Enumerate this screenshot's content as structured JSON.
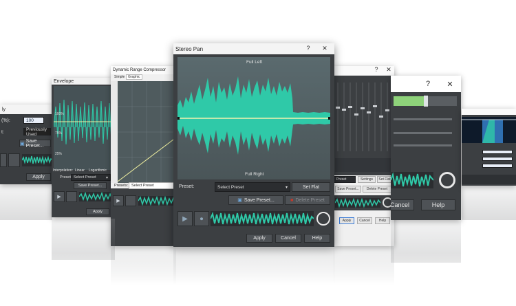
{
  "left_far": {
    "label_pct": "(%):",
    "value": "100",
    "label_t": "t:",
    "preset": "Previously Used",
    "save_preset": "Save Preset...",
    "apply": "Apply"
  },
  "envelope": {
    "title": "Envelope",
    "tick1": "100%",
    "tick2": "75%",
    "tick3": "25%",
    "interp_label": "Interpolation:",
    "linear": "Linear",
    "logarithmic": "Logarithmic",
    "preset_label": "Preset:",
    "preset_value": "Select Preset",
    "save_preset": "Save Preset...",
    "apply": "Apply"
  },
  "compressor": {
    "title": "Dynamic Range Compressor",
    "tabs": [
      "Simple",
      "Graphic"
    ],
    "preset_label": "Presets:",
    "preset_value": "Select Preset"
  },
  "stereo_pan": {
    "title": "Stereo Pan",
    "help_glyph": "?",
    "close_glyph": "✕",
    "full_left": "Full Left",
    "full_right": "Full Right",
    "preset_label": "Preset:",
    "preset_value": "Select Preset",
    "set_flat": "Set Flat",
    "save_preset": "Save Preset...",
    "delete_preset": "Delete Preset",
    "apply": "Apply",
    "cancel": "Cancel",
    "help": "Help"
  },
  "eq": {
    "help_glyph": "?",
    "close_glyph": "✕",
    "preset_value": "Preset",
    "settings": "Settings",
    "set_flat": "Set Flat",
    "save_preset": "Save Preset...",
    "delete_preset": "Delete Preset",
    "apply": "Apply",
    "cancel": "Cancel",
    "help": "Help"
  },
  "right_mid": {
    "help_glyph": "?",
    "close_glyph": "✕",
    "cancel": "Cancel",
    "help": "Help"
  },
  "right_far": {},
  "colors": {
    "wave": "#2fc9a8",
    "wave_dark": "#1f8f79",
    "accent_green": "#8ed27a",
    "panel": "#3c3f42"
  }
}
